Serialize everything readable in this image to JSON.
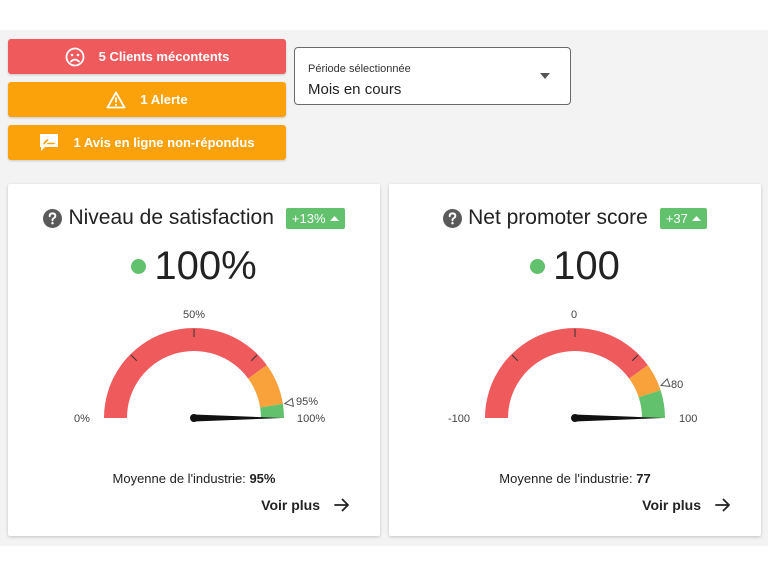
{
  "alerts": {
    "unhappy": "5 Clients mécontents",
    "alert": "1 Alerte",
    "reviews": "1 Avis en ligne non-répondus"
  },
  "period": {
    "label": "Période sélectionnée",
    "value": "Mois en cours"
  },
  "cards": {
    "satisfaction": {
      "title": "Niveau de satisfaction",
      "badge": "+13%",
      "value": "100%",
      "gauge": {
        "label_min": "0%",
        "label_mid": "50%",
        "label_benchmark": "95%",
        "label_max": "100%",
        "min": 0,
        "max": 100,
        "current": 100,
        "benchmark": 95,
        "zones": [
          {
            "from": 0,
            "to": 80,
            "color": "#ef5a5d"
          },
          {
            "from": 80,
            "to": 95,
            "color": "#f9a13a"
          },
          {
            "from": 95,
            "to": 100,
            "color": "#62c16d"
          }
        ]
      },
      "industry_label": "Moyenne de l'industrie:",
      "industry_value": "95%",
      "more": "Voir plus"
    },
    "nps": {
      "title": "Net promoter score",
      "badge": "+37",
      "value": "100",
      "gauge": {
        "label_min": "-100",
        "label_mid": "0",
        "label_benchmark": "80",
        "label_max": "100",
        "min": -100,
        "max": 100,
        "current": 100,
        "benchmark": 77,
        "zones": [
          {
            "from": -100,
            "to": 60,
            "color": "#ef5a5d"
          },
          {
            "from": 60,
            "to": 80,
            "color": "#f9a13a"
          },
          {
            "from": 80,
            "to": 100,
            "color": "#62c16d"
          }
        ]
      },
      "industry_label": "Moyenne de l'industrie:",
      "industry_value": "77",
      "more": "Voir plus"
    }
  },
  "colors": {
    "red": "#ef5a5d",
    "orange": "#fba20a",
    "green": "#62c16d"
  }
}
